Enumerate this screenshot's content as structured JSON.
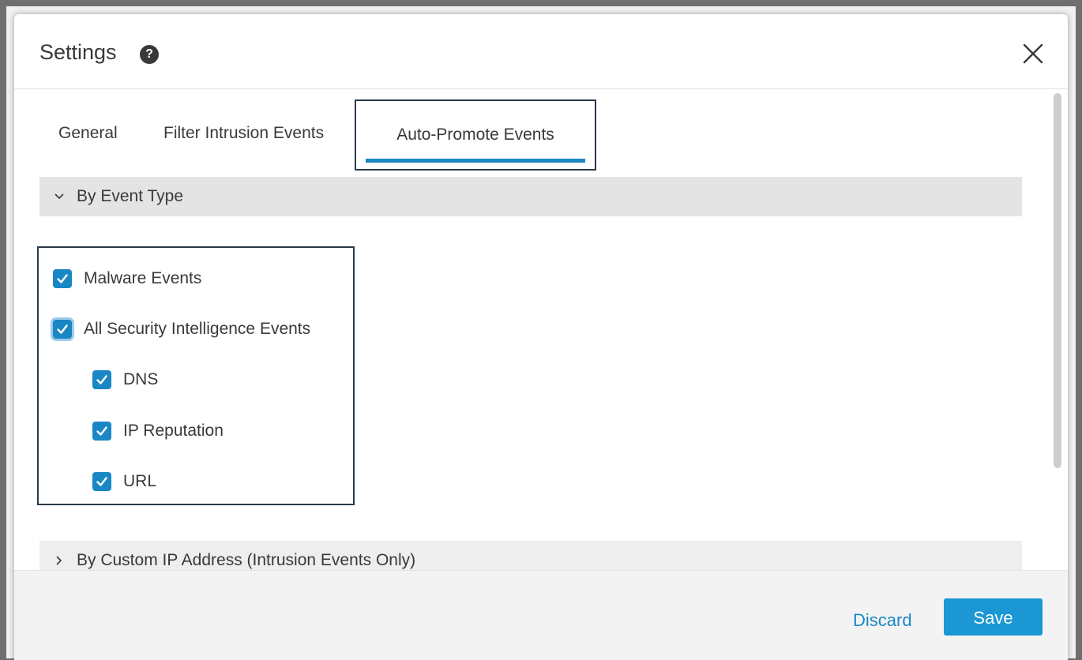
{
  "dialog": {
    "title": "Settings",
    "help_icon": "question-mark-icon",
    "close_icon": "close-icon"
  },
  "tabs": [
    {
      "label": "General",
      "active": false
    },
    {
      "label": "Filter Intrusion Events",
      "active": false
    },
    {
      "label": "Auto-Promote Events",
      "active": true
    }
  ],
  "sections": [
    {
      "label": "By Event Type",
      "expanded": true,
      "icon": "chevron-down-icon",
      "options": [
        {
          "label": "Malware Events",
          "checked": true,
          "level": 0
        },
        {
          "label": "All Security Intelligence Events",
          "checked": true,
          "level": 0,
          "focused": true
        },
        {
          "label": "DNS",
          "checked": true,
          "level": 1
        },
        {
          "label": "IP Reputation",
          "checked": true,
          "level": 1
        },
        {
          "label": "URL",
          "checked": true,
          "level": 1
        }
      ]
    },
    {
      "label": "By Custom IP Address (Intrusion Events Only)",
      "expanded": false,
      "icon": "chevron-right-icon"
    }
  ],
  "footer": {
    "discard_label": "Discard",
    "save_label": "Save"
  },
  "colors": {
    "accent": "#1987c4",
    "save_button": "#1b97d4",
    "section_header_bg": "#e4e4e4",
    "text": "#39393b"
  }
}
